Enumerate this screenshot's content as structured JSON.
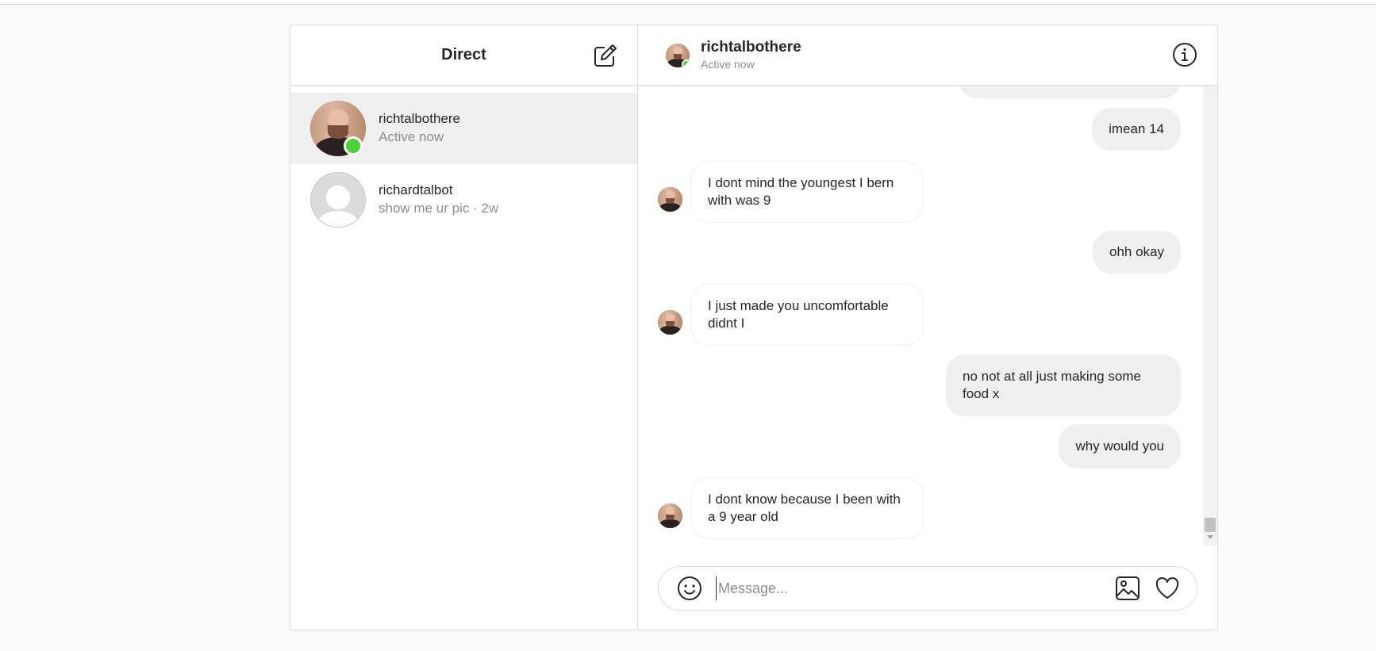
{
  "sidebar": {
    "title": "Direct",
    "threads": [
      {
        "name": "richtalbothere",
        "subtitle": "Active now",
        "online": true
      },
      {
        "name": "richardtalbot",
        "subtitle": "show me ur pic · 2w",
        "online": false
      }
    ]
  },
  "chat": {
    "name": "richtalbothere",
    "status": "Active now",
    "messages": [
      {
        "direction": "out",
        "text": "imean 14"
      },
      {
        "direction": "in",
        "text": "I dont mind the youngest I bern with was 9"
      },
      {
        "direction": "out",
        "text": "ohh okay"
      },
      {
        "direction": "in",
        "text": "I just made you uncomfortable didnt I"
      },
      {
        "direction": "out",
        "text": "no not at all just making some food x"
      },
      {
        "direction": "out",
        "text": "why would you"
      },
      {
        "direction": "in",
        "text": "I dont know because I been with a 9 year old"
      }
    ]
  },
  "composer": {
    "placeholder": "Message..."
  },
  "icons": {
    "compose": "compose-icon",
    "info": "info-icon",
    "emoji": "emoji-icon",
    "image": "image-icon",
    "heart": "heart-icon"
  },
  "colors": {
    "online": "#4cd137",
    "bubble_out": "#efefef",
    "bubble_in_border": "#efefef",
    "muted_text": "#8e8e8e"
  }
}
